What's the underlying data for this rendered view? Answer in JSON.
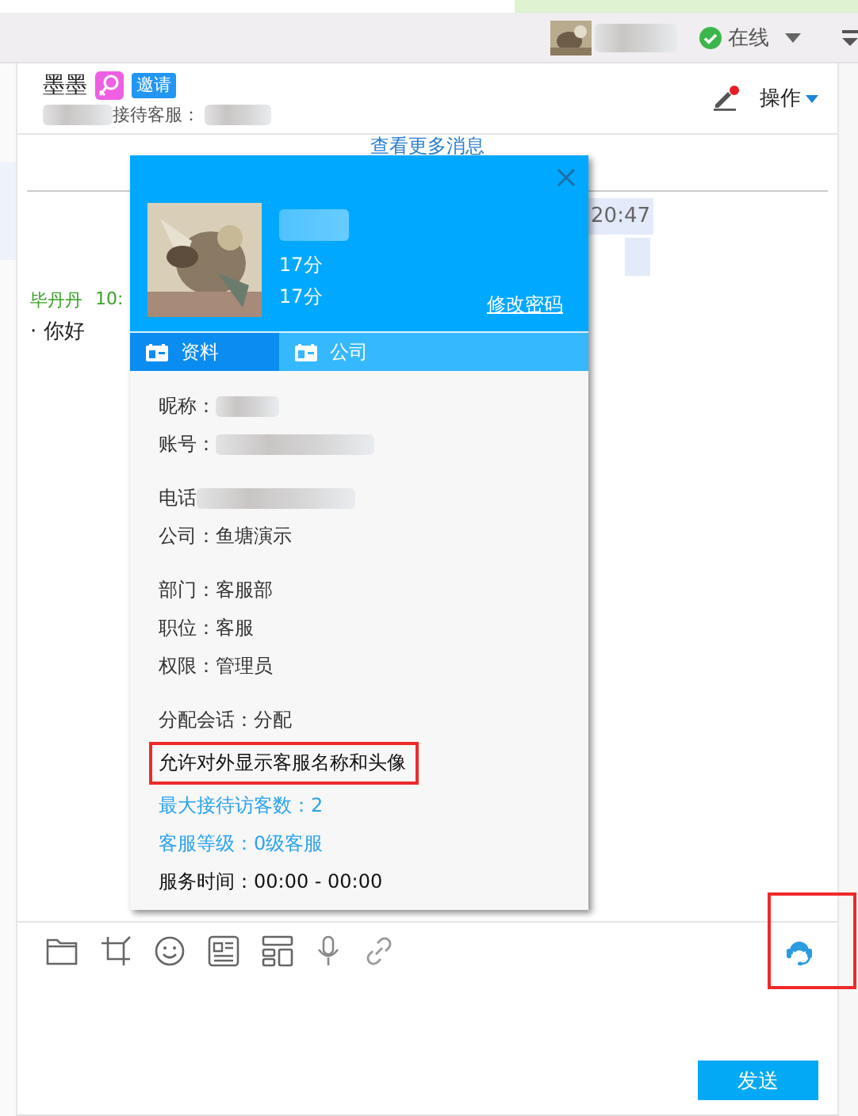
{
  "topbar": {
    "status": "在线"
  },
  "chat": {
    "title": "墨墨",
    "gender_icon": {
      "kind": "female"
    },
    "badge": "邀请",
    "agent_label": "接待客服：",
    "action_menu": "操作",
    "more_messages": "查看更多消息",
    "messages": [
      {
        "kind": "outgoing",
        "time": "20:47"
      },
      {
        "kind": "outgoing"
      },
      {
        "kind": "incoming",
        "sender": "毕丹丹",
        "time": "10:",
        "text": "· 你好"
      }
    ]
  },
  "profile": {
    "scores": [
      "17分",
      "17分"
    ],
    "change_password": "修改密码",
    "tabs": [
      {
        "label": "资料",
        "selected": true
      },
      {
        "label": "公司",
        "selected": false
      }
    ],
    "groups": [
      [
        {
          "label": "昵称：",
          "blurred": true
        },
        {
          "label": "账号：",
          "blurred": true
        }
      ],
      [
        {
          "label": "电话",
          "blurred": true
        },
        {
          "label": "公司：鱼塘演示",
          "blurred": false
        }
      ],
      [
        {
          "label": "部门：客服部",
          "blurred": false
        },
        {
          "label": "职位：客服",
          "blurred": false
        },
        {
          "label": "权限：管理员",
          "blurred": false
        }
      ],
      [
        {
          "label": "分配会话：分配",
          "blurred": false,
          "highlighted": false,
          "color": "#333333"
        },
        {
          "label": "允许对外显示客服名称和头像",
          "blurred": false,
          "highlighted": true,
          "color": "#111111"
        },
        {
          "label": "最大接待访客数：2",
          "blurred": false,
          "highlighted": false,
          "color": "#29a3ee"
        },
        {
          "label": "客服等级：0级客服",
          "blurred": false,
          "highlighted": false,
          "color": "#29a3ee"
        },
        {
          "label": "服务时间：00:00 - 00:00",
          "blurred": false,
          "highlighted": false,
          "color": "#111111"
        }
      ]
    ]
  },
  "toolbar": {
    "assistant_highlighted": true
  },
  "send_button": "发送"
}
